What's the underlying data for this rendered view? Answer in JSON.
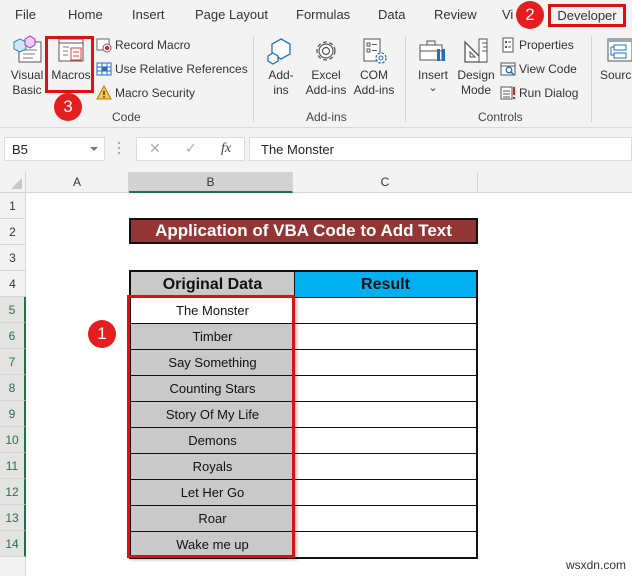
{
  "tabs": [
    {
      "label": "File"
    },
    {
      "label": "Home"
    },
    {
      "label": "Insert"
    },
    {
      "label": "Page Layout"
    },
    {
      "label": "Formulas"
    },
    {
      "label": "Data"
    },
    {
      "label": "Review"
    },
    {
      "label": "Vi"
    },
    {
      "label": "Developer",
      "active": true
    }
  ],
  "ribbon": {
    "code_group": {
      "label": "Code",
      "visual_basic": "Visual\nBasic",
      "visual_basic_l1": "Visual",
      "visual_basic_l2": "Basic",
      "macros": "Macros",
      "record_macro": "Record Macro",
      "use_relative_references": "Use Relative References",
      "macro_security": "Macro Security"
    },
    "addins_group": {
      "label": "Add-ins",
      "addins_l1": "Add-",
      "addins_l2": "ins",
      "excel_addins_l1": "Excel",
      "excel_addins_l2": "Add-ins",
      "com_addins_l1": "COM",
      "com_addins_l2": "Add-ins"
    },
    "controls_group": {
      "label": "Controls",
      "insert": "Insert",
      "insert_caret": "⌄",
      "design_mode_l1": "Design",
      "design_mode_l2": "Mode",
      "properties": "Properties",
      "view_code": "View Code",
      "run_dialog": "Run Dialog"
    },
    "source": "Sourc"
  },
  "formula_bar": {
    "name_box": "B5",
    "cancel_icon": "✕",
    "enter_icon": "✓",
    "fx_label": "fx",
    "value": "The Monster"
  },
  "sheet": {
    "columns": [
      "A",
      "B",
      "C"
    ],
    "selected_column": "B",
    "rows": [
      "1",
      "2",
      "3",
      "4",
      "5",
      "6",
      "7",
      "8",
      "9",
      "10",
      "11",
      "12",
      "13",
      "14"
    ],
    "selected_row": "5",
    "title": "Application of VBA Code to Add Text",
    "table": {
      "headers": [
        "Original Data",
        "Result"
      ],
      "rows": [
        [
          "The Monster",
          ""
        ],
        [
          "Timber",
          ""
        ],
        [
          "Say Something",
          ""
        ],
        [
          "Counting Stars",
          ""
        ],
        [
          "Story Of My Life",
          ""
        ],
        [
          "Demons",
          ""
        ],
        [
          "Royals",
          ""
        ],
        [
          "Let Her Go",
          ""
        ],
        [
          "Roar",
          ""
        ],
        [
          "Wake me up",
          ""
        ]
      ]
    }
  },
  "annotations": {
    "step1": "1",
    "step2": "2",
    "step3": "3"
  },
  "colors": {
    "title_bg": "#943634",
    "result_header_bg": "#00b0f0",
    "original_data_bg": "#c9c9c9",
    "highlight_red": "#e01010",
    "excel_green": "#217346"
  },
  "watermark": "wsxdn.com"
}
